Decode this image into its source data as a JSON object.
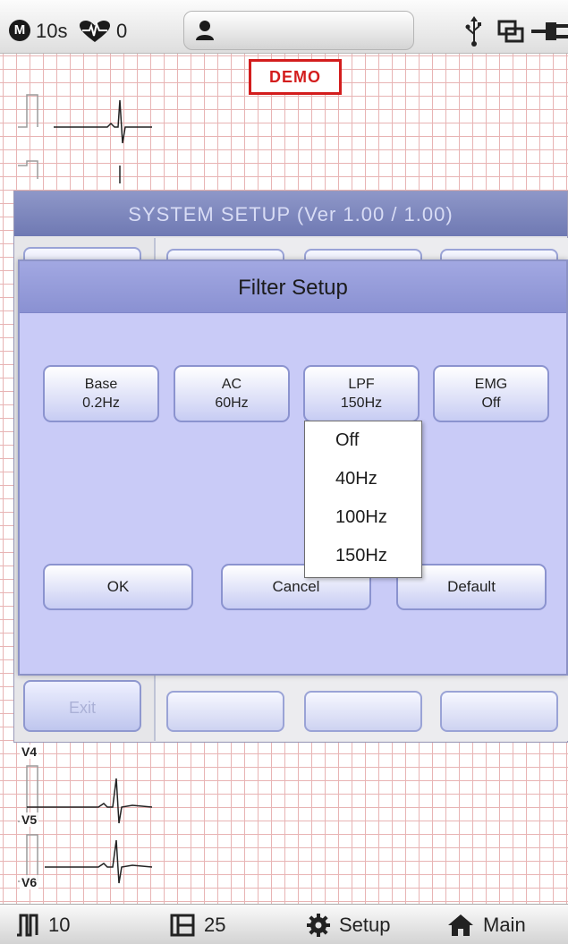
{
  "status_bar": {
    "mode_letter": "M",
    "duration": "10s",
    "heart_rate": "0",
    "icons": [
      "mode-icon",
      "heart-icon",
      "person-icon",
      "usb-icon",
      "network-icon",
      "ac-power-icon"
    ]
  },
  "ecg": {
    "demo_label": "DEMO",
    "leads": [
      "V4",
      "V5",
      "V6"
    ]
  },
  "system_setup": {
    "title": "SYSTEM SETUP (Ver 1.00 / 1.00)",
    "exit_label": "Exit"
  },
  "filter_setup": {
    "title": "Filter Setup",
    "filters": [
      {
        "name": "Base",
        "value": "0.2Hz"
      },
      {
        "name": "AC",
        "value": "60Hz"
      },
      {
        "name": "LPF",
        "value": "150Hz"
      },
      {
        "name": "EMG",
        "value": "Off"
      }
    ],
    "lpf_options": [
      "Off",
      "40Hz",
      "100Hz",
      "150Hz"
    ],
    "ok_label": "OK",
    "cancel_label": "Cancel",
    "default_label": "Default"
  },
  "bottom_bar": {
    "speed": "10",
    "gain": "25",
    "setup_label": "Setup",
    "main_label": "Main"
  },
  "colors": {
    "dialog_background": "#c9cbf7",
    "dialog_title_bar": "#8a91d2",
    "grid_line": "#e8b4b4",
    "demo_red": "#d31d1d"
  }
}
